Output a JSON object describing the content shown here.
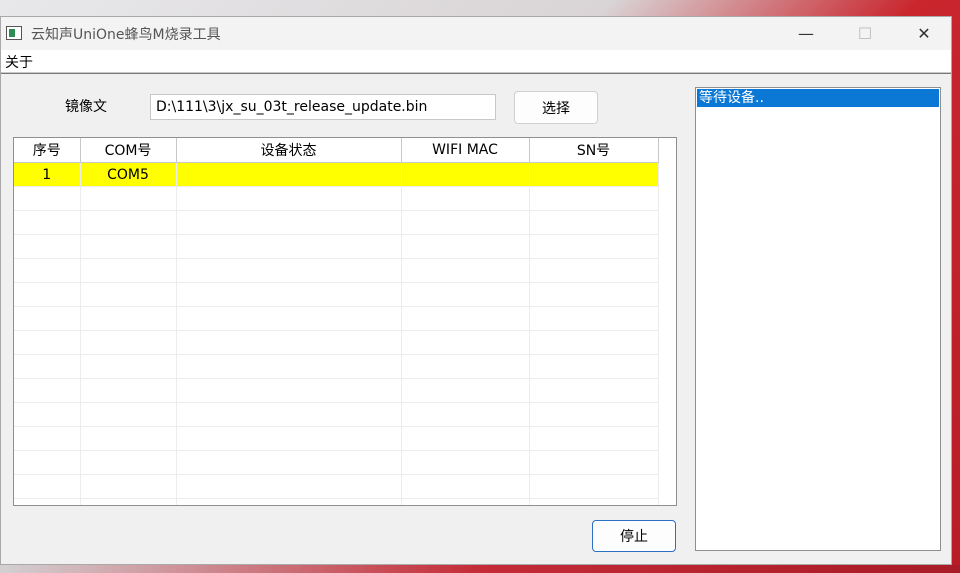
{
  "window": {
    "title": "云知声UniOne蜂鸟M烧录工具",
    "controls": {
      "minimize": "—",
      "maximize": "☐",
      "close": "✕"
    }
  },
  "menu": {
    "about": "关于"
  },
  "image_file": {
    "label": "镜像文",
    "path": "D:\\111\\3\\jx_su_03t_release_update.bin",
    "select_button": "选择"
  },
  "table": {
    "columns": [
      "序号",
      "COM号",
      "设备状态",
      "WIFI MAC",
      "SN号"
    ],
    "rows": [
      [
        "1",
        "COM5",
        "",
        "",
        ""
      ]
    ],
    "highlight_color": "#ffff00"
  },
  "log": {
    "lines": [
      "等待设备.."
    ]
  },
  "actions": {
    "stop_button": "停止"
  }
}
